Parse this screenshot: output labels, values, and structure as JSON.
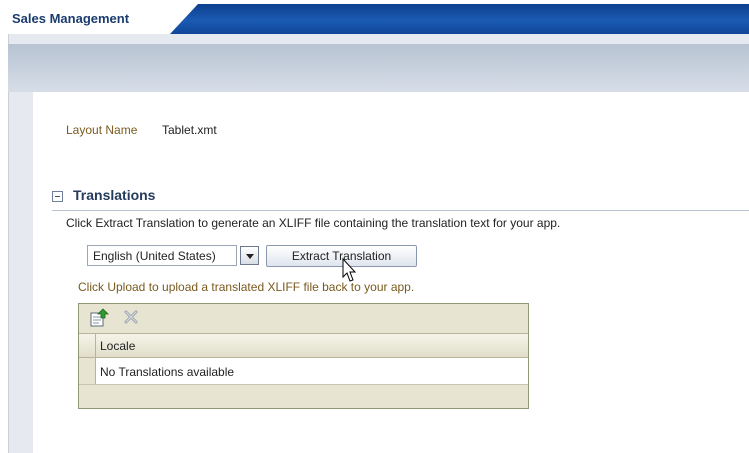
{
  "app": {
    "title": "Sales Management"
  },
  "layout": {
    "label": "Layout Name",
    "value": "Tablet.xmt"
  },
  "translations": {
    "title": "Translations",
    "instruction": "Click Extract Translation to generate an XLIFF file containing the translation text for your app.",
    "locale_select": {
      "selected": "English (United States)"
    },
    "extract_button": "Extract Translation",
    "upload_hint": "Click Upload to upload a translated XLIFF file back to your app.",
    "toolbar": {
      "upload_icon": "upload-icon",
      "delete_icon": "delete-icon"
    },
    "table": {
      "columns": [
        "Locale"
      ],
      "rows": [
        [
          "No Translations available"
        ]
      ]
    }
  },
  "colors": {
    "header_blue": "#1b5bb3",
    "label_brown": "#7a5a1e",
    "panel_tan": "#e7e5d1"
  }
}
